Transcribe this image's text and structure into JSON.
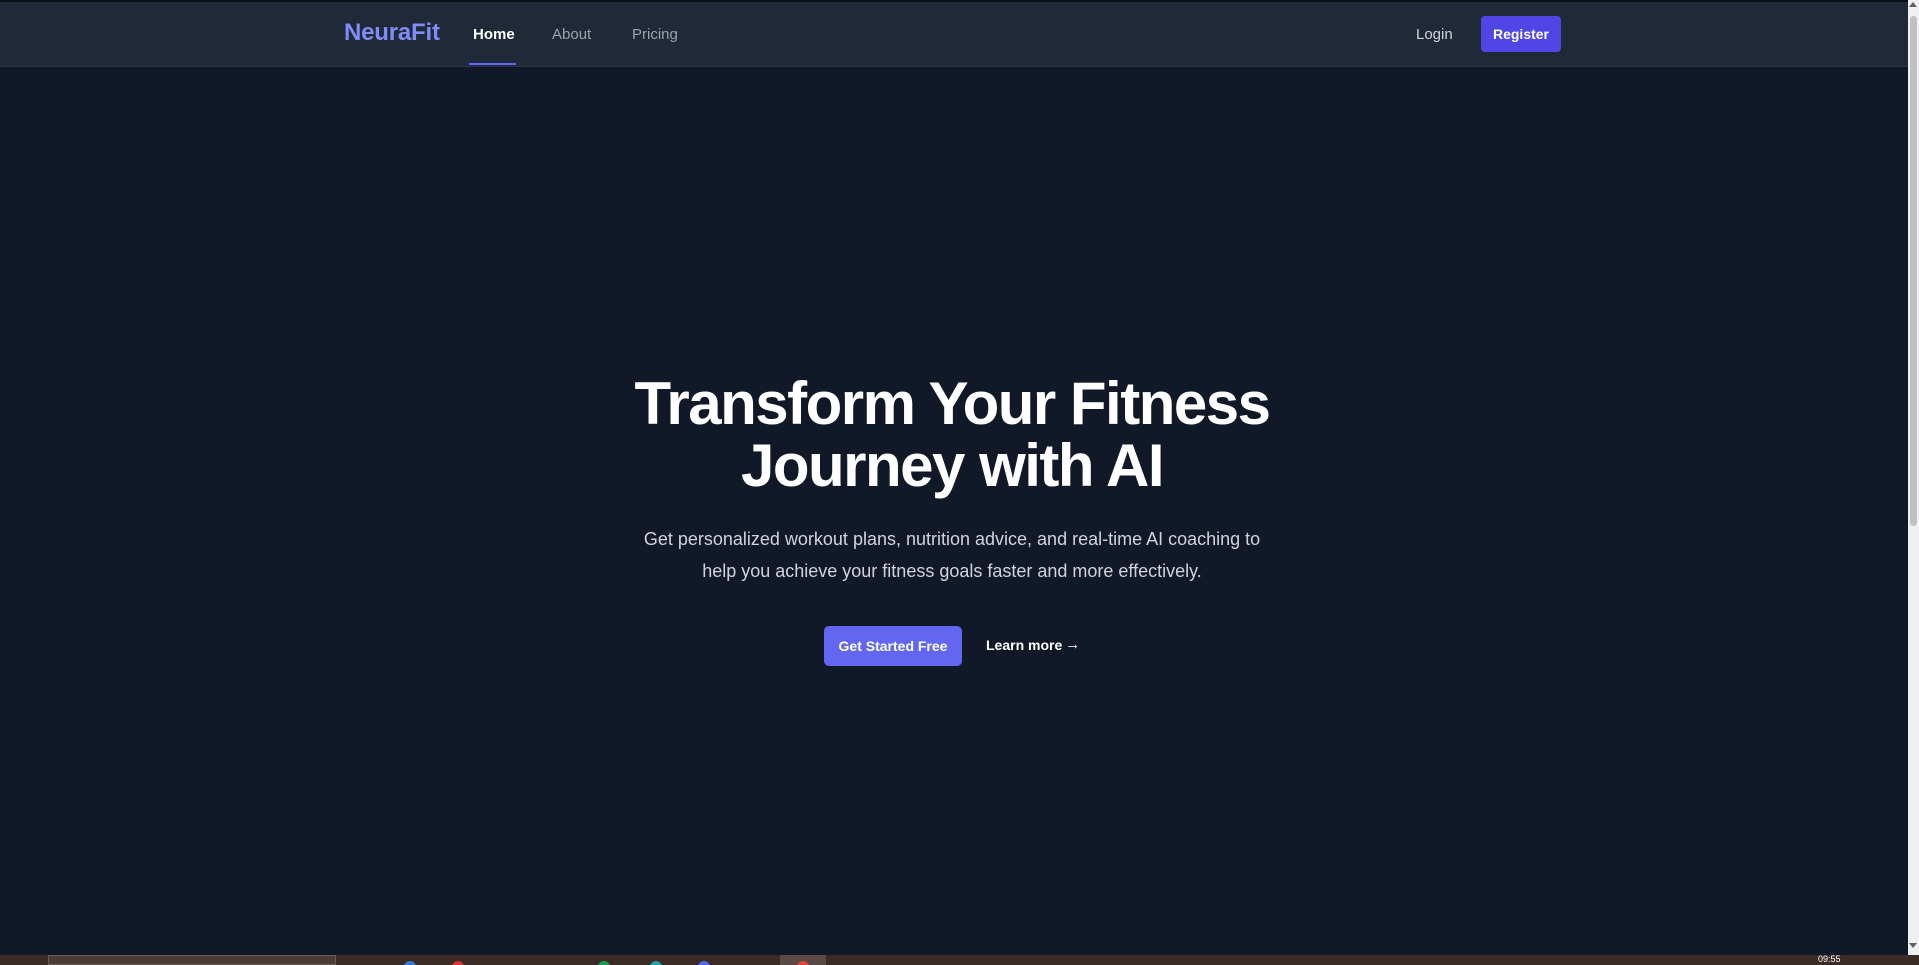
{
  "navbar": {
    "brand": "NeuraFit",
    "links": [
      {
        "label": "Home",
        "active": true
      },
      {
        "label": "About",
        "active": false
      },
      {
        "label": "Pricing",
        "active": false
      }
    ],
    "login_label": "Login",
    "register_label": "Register"
  },
  "hero": {
    "title_line1": "Transform Your Fitness",
    "title_line2": "Journey with AI",
    "subtitle_line1": "Get personalized workout plans, nutrition advice, and real-time AI coaching to",
    "subtitle_line2": "help you achieve your fitness goals faster and more effectively.",
    "primary_cta": "Get Started Free",
    "secondary_cta": "Learn more",
    "secondary_cta_icon": "→"
  },
  "taskbar": {
    "clock": "09:55"
  },
  "colors": {
    "background": "#111827",
    "navbar": "#1f2937",
    "brand": "#818cf8",
    "accent": "#6366f1",
    "register": "#4f46e5"
  }
}
